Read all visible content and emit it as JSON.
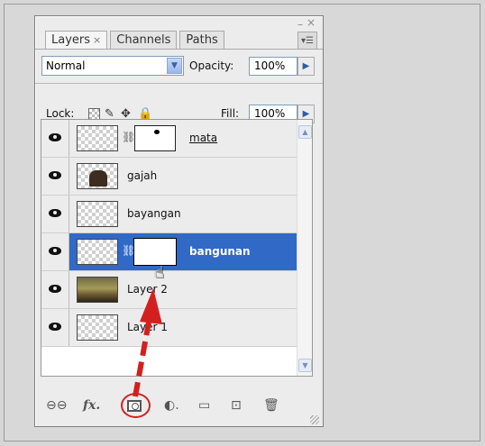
{
  "tabs": [
    {
      "label": "Layers",
      "close": "×"
    },
    {
      "label": "Channels"
    },
    {
      "label": "Paths"
    }
  ],
  "window_controls": {
    "minimize": "–",
    "close": "×"
  },
  "panel_menu_icon": "panel-menu-icon",
  "blend_mode": {
    "value": "Normal"
  },
  "opacity": {
    "label": "Opacity:",
    "value": "100%"
  },
  "lock": {
    "label": "Lock:"
  },
  "fill": {
    "label": "Fill:",
    "value": "100%"
  },
  "layers": [
    {
      "name": "mata",
      "thumb": "transparent",
      "mask": true,
      "selected": false
    },
    {
      "name": "gajah",
      "thumb": "elephant",
      "mask": false,
      "selected": false
    },
    {
      "name": "bayangan",
      "thumb": "transparent",
      "mask": false,
      "selected": false
    },
    {
      "name": "bangunan",
      "thumb": "transparent",
      "mask": true,
      "selected": true
    },
    {
      "name": "Layer 2",
      "thumb": "photo",
      "mask": false,
      "selected": false
    },
    {
      "name": "Layer 1",
      "thumb": "transparent",
      "mask": false,
      "selected": false
    }
  ],
  "bottom_icons": [
    "link-layers-icon",
    "fx-icon",
    "add-mask-icon",
    "adjustment-layer-icon",
    "new-group-icon",
    "new-layer-icon",
    "trash-icon"
  ],
  "colors": {
    "selection": "#3169c6",
    "annotation": "#d3201f"
  }
}
